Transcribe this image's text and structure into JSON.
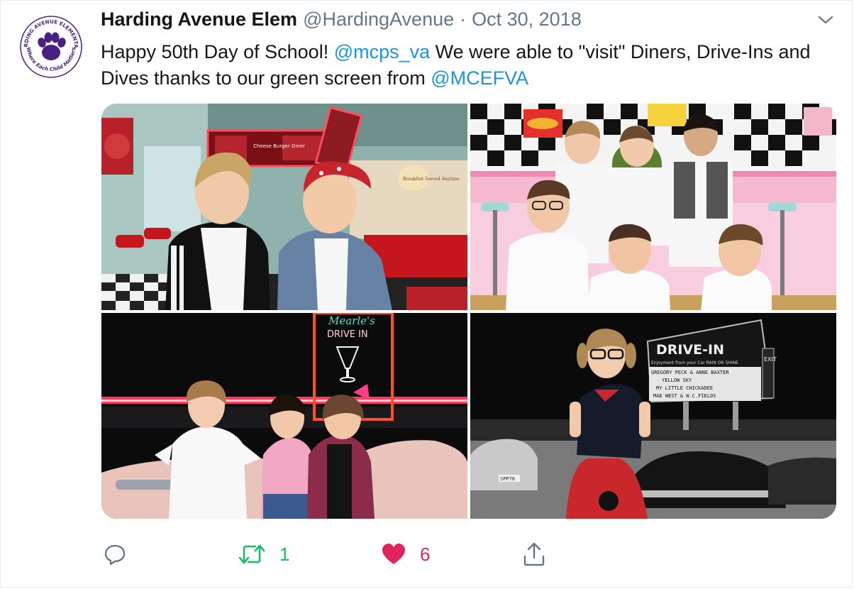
{
  "account": {
    "name": "Harding Avenue Elem",
    "handle": "@HardingAvenue",
    "separator": "·",
    "date": "Oct 30, 2018",
    "avatar_ring_text_top": "HARDING AVENUE ELEMENTARY",
    "avatar_ring_text_bottom": "Where Each Child Matters"
  },
  "tweet": {
    "part1": "Happy 50th Day of School!  ",
    "mention1": "@mcps_va",
    "part2": " We were able to \"visit\" Diners, Drive-Ins and Dives thanks to our green screen from ",
    "mention2": "@MCEFVA"
  },
  "photos": {
    "diner_sign": "Breakfast Served Anytime",
    "diner_menu": "Cheese Burger Diner",
    "drivein_neon_name": "Mearle's",
    "drivein_neon_sub": "DRIVE IN",
    "marquee_title": "DRIVE-IN",
    "marquee_sub": "Enjoyment from your Car  RAIN OR SHINE",
    "marquee_line1": "GREGORY PECK & ANNE BAXTER",
    "marquee_line2": "YELLOW SKY",
    "marquee_line3": "MY LITTLE CHICKADEE",
    "marquee_line4": "MAE WEST & W.C.FIELDS",
    "marquee_exit": "EXIT",
    "license_plate": "SPP76"
  },
  "actions": {
    "reply_icon": "reply-icon",
    "retweet_icon": "retweet-icon",
    "retweet_count": "1",
    "like_icon": "heart-icon",
    "like_count": "6",
    "share_icon": "share-icon"
  },
  "colors": {
    "text": "#14171a",
    "muted": "#657786",
    "link": "#1b95e0",
    "retweet": "#17bf63",
    "like": "#e0245e",
    "avatar_purple": "#4b1f82"
  }
}
